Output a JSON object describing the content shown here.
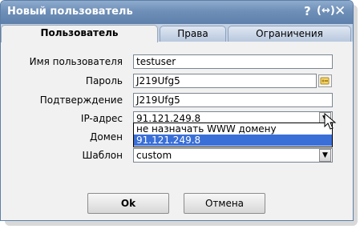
{
  "dialog": {
    "title": "Новый пользователь",
    "help_icon": "?",
    "resize_icon": "(↔)",
    "close_icon": "✕"
  },
  "tabs": [
    {
      "label": "Пользователь",
      "active": true
    },
    {
      "label": "Права",
      "active": false
    },
    {
      "label": "Ограничения",
      "active": false
    }
  ],
  "form": {
    "username": {
      "label": "Имя пользователя",
      "value": "testuser"
    },
    "password": {
      "label": "Пароль",
      "value": "J219Ufg5"
    },
    "confirm": {
      "label": "Подтверждение",
      "value": "J219Ufg5"
    },
    "ip": {
      "label": "IP-адрес",
      "value": "91.121.249.8",
      "options": [
        "не назначать WWW домену",
        "91.121.249.8"
      ],
      "selected_index": 1
    },
    "domain": {
      "label": "Домен"
    },
    "template": {
      "label": "Шаблон",
      "value": "custom"
    }
  },
  "buttons": {
    "ok": "Ok",
    "cancel": "Отмена"
  },
  "colors": {
    "titlebar": "#6e8fb8",
    "selected_option": "#3a6fd8",
    "panel": "#f1f1f1"
  }
}
